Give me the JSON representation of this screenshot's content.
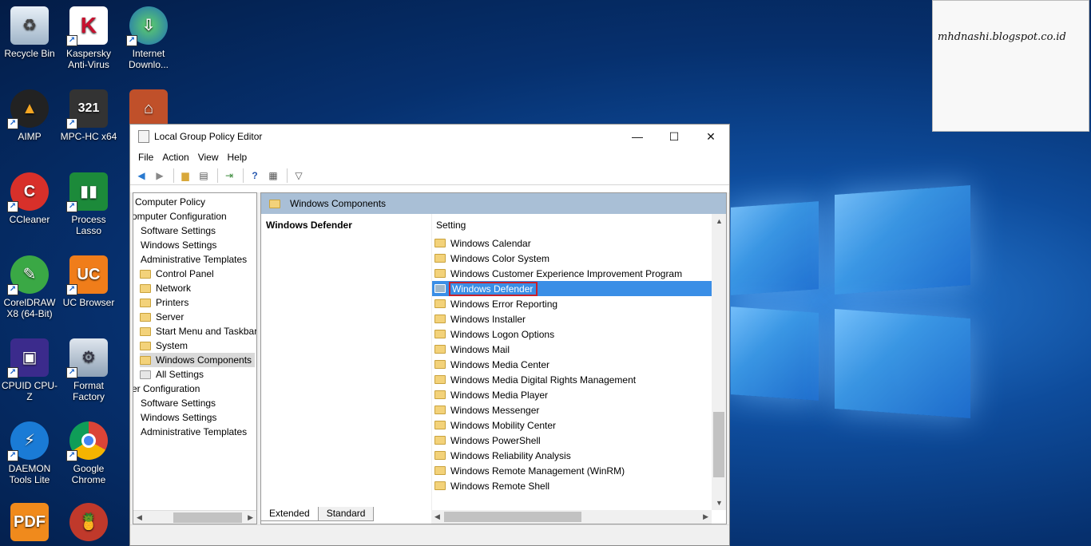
{
  "desktop": {
    "icons": [
      {
        "label": "Recycle Bin"
      },
      {
        "label": "Kaspersky Anti-Virus"
      },
      {
        "label": "Internet Downlo..."
      },
      {
        "label": "AIMP"
      },
      {
        "label": "MPC-HC x64"
      },
      {
        "label": "CCleaner"
      },
      {
        "label": "Process Lasso"
      },
      {
        "label": "CorelDRAW X8 (64-Bit)"
      },
      {
        "label": "UC Browser"
      },
      {
        "label": "CPUID CPU-Z"
      },
      {
        "label": "Format Factory"
      },
      {
        "label": "DAEMON Tools Lite"
      },
      {
        "label": "Google Chrome"
      }
    ],
    "note_text": "mhdnashi.blogspot.co.id"
  },
  "window": {
    "title": "Local Group Policy Editor",
    "menu": [
      "File",
      "Action",
      "View",
      "Help"
    ],
    "tree": [
      "Computer Policy",
      "omputer Configuration",
      "Software Settings",
      "Windows Settings",
      "Administrative Templates",
      "Control Panel",
      "Network",
      "Printers",
      "Server",
      "Start Menu and Taskbar",
      "System",
      "Windows Components",
      "All Settings",
      "er Configuration",
      "Software Settings",
      "Windows Settings",
      "Administrative Templates"
    ],
    "right_header": "Windows Components",
    "detail_title": "Windows Defender",
    "column_header": "Setting",
    "settings": [
      "Windows Calendar",
      "Windows Color System",
      "Windows Customer Experience Improvement Program",
      "Windows Defender",
      "Windows Error Reporting",
      "Windows Installer",
      "Windows Logon Options",
      "Windows Mail",
      "Windows Media Center",
      "Windows Media Digital Rights Management",
      "Windows Media Player",
      "Windows Messenger",
      "Windows Mobility Center",
      "Windows PowerShell",
      "Windows Reliability Analysis",
      "Windows Remote Management (WinRM)",
      "Windows Remote Shell"
    ],
    "selected_setting": "Windows Defender",
    "tabs": [
      "Extended",
      "Standard"
    ]
  }
}
